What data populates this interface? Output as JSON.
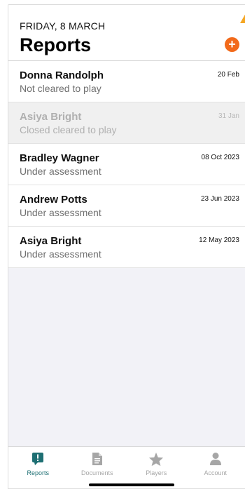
{
  "header": {
    "date": "FRIDAY, 8 MARCH",
    "title": "Reports",
    "add_symbol": "+"
  },
  "reports": [
    {
      "name": "Donna Randolph",
      "status": "Not cleared to play",
      "date": "20 Feb",
      "muted": false
    },
    {
      "name": "Asiya Bright",
      "status": "Closed cleared to play",
      "date": "31 Jan",
      "muted": true
    },
    {
      "name": "Bradley Wagner",
      "status": "Under assessment",
      "date": "08 Oct 2023",
      "muted": false
    },
    {
      "name": "Andrew Potts",
      "status": "Under assessment",
      "date": "23 Jun 2023",
      "muted": false
    },
    {
      "name": "Asiya Bright",
      "status": "Under assessment",
      "date": "12 May 2023",
      "muted": false
    }
  ],
  "tabs": [
    {
      "label": "Reports",
      "icon": "reports-icon",
      "active": true
    },
    {
      "label": "Documents",
      "icon": "document-icon",
      "active": false
    },
    {
      "label": "Players",
      "icon": "star-icon",
      "active": false
    },
    {
      "label": "Account",
      "icon": "person-icon",
      "active": false
    }
  ],
  "colors": {
    "accent": "#f26a1b",
    "active_tab": "#1e6f73",
    "inactive_tab": "#a6a6a6"
  }
}
